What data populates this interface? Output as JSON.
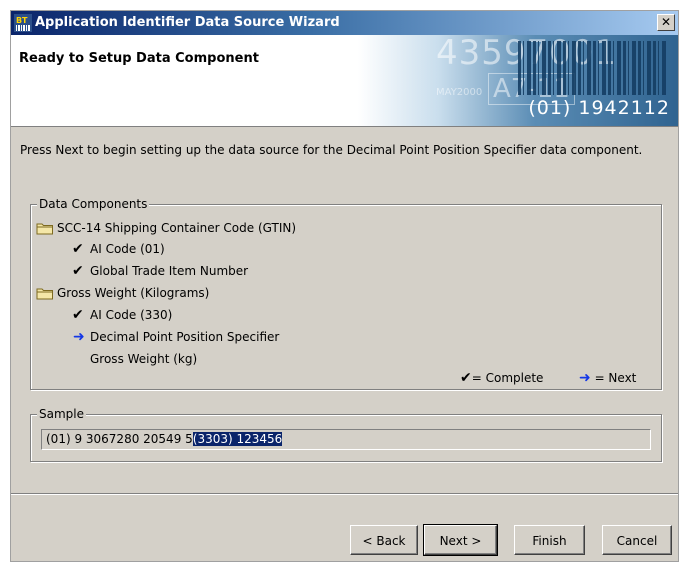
{
  "window": {
    "title": "Application Identifier Data Source Wizard",
    "close_glyph": "✕"
  },
  "header": {
    "title": "Ready to Setup Data Component",
    "banner": {
      "big_number": "43597001",
      "box_text": "A7-11",
      "small_text": "MAY2000",
      "code_text": "(01) 1942112"
    }
  },
  "instruction": "Press Next to begin setting up the data source for the Decimal Point Position Specifier data component.",
  "components": {
    "legend": "Data Components",
    "items": [
      {
        "type": "folder",
        "label": "SCC-14 Shipping Container Code (GTIN)"
      },
      {
        "type": "complete",
        "label": "AI Code (01)"
      },
      {
        "type": "complete",
        "label": "Global Trade Item Number"
      },
      {
        "type": "folder",
        "label": "Gross Weight (Kilograms)"
      },
      {
        "type": "complete",
        "label": "AI Code (330)"
      },
      {
        "type": "next",
        "label": "Decimal Point Position Specifier"
      },
      {
        "type": "pending",
        "label": "Gross Weight (kg)"
      }
    ],
    "key_complete": "= Complete",
    "key_next": "= Next",
    "check_glyph": "✔",
    "arrow_glyph": "➜"
  },
  "sample": {
    "legend": "Sample",
    "prefix": "(01) 9 3067280 20549 5",
    "selected": "(3303) 123456"
  },
  "buttons": {
    "back": "< Back",
    "next": "Next >",
    "finish": "Finish",
    "cancel": "Cancel"
  },
  "colors": {
    "title_start": "#0a246a",
    "face": "#d4d0c8",
    "arrow": "#1437e6",
    "selection": "#0a246a"
  }
}
